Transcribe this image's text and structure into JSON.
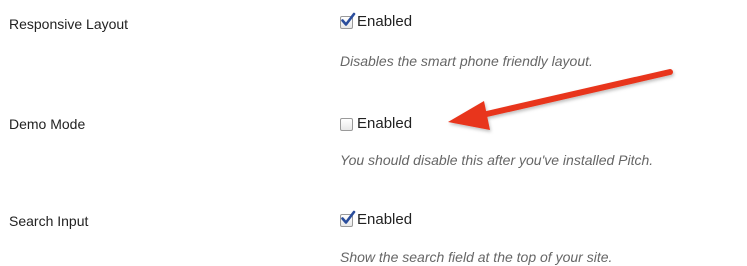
{
  "settings": [
    {
      "label": "Responsive Layout",
      "checked": true,
      "option_label": "Enabled",
      "description": "Disables the smart phone friendly layout."
    },
    {
      "label": "Demo Mode",
      "checked": false,
      "option_label": "Enabled",
      "description": "You should disable this after you've installed Pitch."
    },
    {
      "label": "Search Input",
      "checked": true,
      "option_label": "Enabled",
      "description": "Show the search field at the top of your site."
    }
  ],
  "annotation": {
    "arrow_color": "#e8361c"
  },
  "colors": {
    "checkmark": "#2a4d9c",
    "description_text": "#666666"
  }
}
